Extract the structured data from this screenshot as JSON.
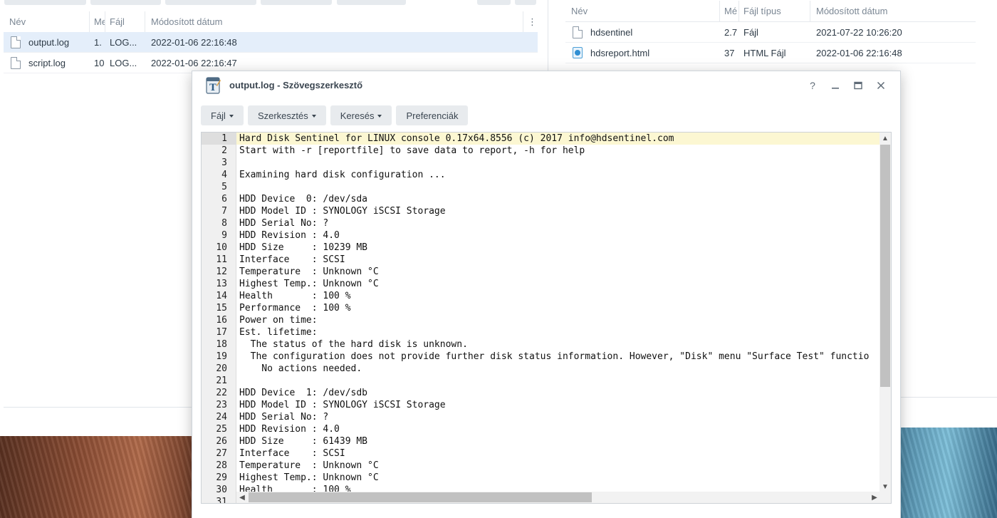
{
  "left_pane": {
    "columns": [
      "Név",
      "Me",
      "Fájl",
      "Módosított dátum"
    ],
    "rows": [
      {
        "name": "output.log",
        "size": "1.",
        "type": "LOG...",
        "date": "2022-01-06 22:16:48"
      },
      {
        "name": "script.log",
        "size": "10",
        "type": "LOG...",
        "date": "2022-01-06 22:16:47"
      }
    ]
  },
  "right_pane": {
    "columns": [
      "Név",
      "Mé",
      "Fájl típus",
      "Módosított dátum"
    ],
    "rows": [
      {
        "name": "hdsentinel",
        "size": "2.7",
        "type": "Fájl",
        "date": "2021-07-22 10:26:20"
      },
      {
        "name": "hdsreport.html",
        "size": "37",
        "type": "HTML Fájl",
        "date": "2022-01-06 22:16:48"
      }
    ]
  },
  "editor": {
    "title": "output.log - Szövegszerkesztő",
    "window_buttons": {
      "help": "?",
      "minimize": "–",
      "maximize": "▭",
      "close": "✕"
    },
    "menu": [
      "Fájl",
      "Szerkesztés",
      "Keresés",
      "Preferenciák"
    ],
    "lines": [
      "Hard Disk Sentinel for LINUX console 0.17x64.8556 (c) 2017 info@hdsentinel.com",
      "Start with -r [reportfile] to save data to report, -h for help",
      "",
      "Examining hard disk configuration ...",
      "",
      "HDD Device  0: /dev/sda",
      "HDD Model ID : SYNOLOGY iSCSI Storage",
      "HDD Serial No: ?",
      "HDD Revision : 4.0",
      "HDD Size     : 10239 MB",
      "Interface    : SCSI",
      "Temperature  : Unknown °C",
      "Highest Temp.: Unknown °C",
      "Health       : 100 %",
      "Performance  : 100 %",
      "Power on time:",
      "Est. lifetime:",
      "  The status of the hard disk is unknown.",
      "  The configuration does not provide further disk status information. However, \"Disk\" menu \"Surface Test\" functio",
      "    No actions needed.",
      "",
      "HDD Device  1: /dev/sdb",
      "HDD Model ID : SYNOLOGY iSCSI Storage",
      "HDD Serial No: ?",
      "HDD Revision : 4.0",
      "HDD Size     : 61439 MB",
      "Interface    : SCSI",
      "Temperature  : Unknown °C",
      "Highest Temp.: Unknown °C",
      "Health       : 100 %",
      ""
    ]
  }
}
